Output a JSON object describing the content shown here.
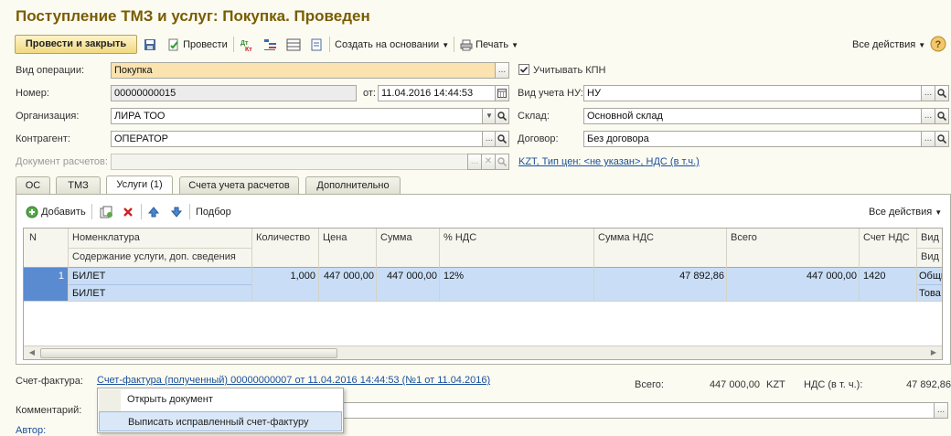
{
  "title": "Поступление ТМЗ и услуг: Покупка. Проведен",
  "toolbar": {
    "post_close": "Провести и закрыть",
    "post": "Провести",
    "create_based": "Создать на основании",
    "print": "Печать",
    "all_actions": "Все действия"
  },
  "form": {
    "operation_label": "Вид операции:",
    "operation_value": "Покупка",
    "kpn_label": "Учитывать КПН",
    "number_label": "Номер:",
    "number_value": "00000000015",
    "from_label": "от:",
    "date_value": "11.04.2016 14:44:53",
    "tax_account_label": "Вид учета НУ:",
    "tax_account_value": "НУ",
    "org_label": "Организация:",
    "org_value": "ЛИРА ТОО",
    "warehouse_label": "Склад:",
    "warehouse_value": "Основной склад",
    "contractor_label": "Контрагент:",
    "contractor_value": "ОПЕРАТОР",
    "contract_label": "Договор:",
    "contract_value": "Без договора",
    "settlement_doc_label": "Документ расчетов:",
    "price_link": "KZT, Тип цен: <не указан>, НДС (в т.ч.)"
  },
  "tabs": [
    "ОС",
    "ТМЗ",
    "Услуги (1)",
    "Счета учета расчетов",
    "Дополнительно"
  ],
  "table_toolbar": {
    "add": "Добавить",
    "selection": "Подбор",
    "all_actions": "Все действия"
  },
  "table": {
    "headers": {
      "n": "N",
      "nomenclature": "Номенклатура",
      "content": "Содержание услуги, доп. сведения",
      "qty": "Количество",
      "price": "Цена",
      "sum": "Сумма",
      "vat_pct": "% НДС",
      "vat_sum": "Сумма НДС",
      "total": "Всего",
      "vat_account": "Счет НДС",
      "type1": "Вид о",
      "type2": "Вид п"
    },
    "rows": [
      {
        "n": "1",
        "nomenclature": "БИЛЕТ",
        "content": "БИЛЕТ",
        "qty": "1,000",
        "price": "447 000,00",
        "sum": "447 000,00",
        "vat_pct": "12%",
        "vat_sum": "47 892,86",
        "total": "447 000,00",
        "vat_account": "1420",
        "type1": "Общи",
        "type2": "Това"
      }
    ]
  },
  "footer": {
    "invoice_label": "Счет-фактура:",
    "invoice_link": "Счет-фактура (полученный) 00000000007 от 11.04.2016 14:44:53 (№1 от 11.04.2016)",
    "total_label": "Всего:",
    "total_value": "447 000,00",
    "currency": "KZT",
    "vat_label": "НДС (в т. ч.):",
    "vat_value": "47 892,86",
    "comment_label": "Комментарий:",
    "author_label": "Автор:"
  },
  "popup_menu": {
    "items": [
      "Открыть документ",
      "Выписать исправленный счет-фактуру"
    ]
  },
  "colors": {
    "title": "#7a5c00",
    "primary_button": "#f1d980",
    "selected_row": "#c9def6",
    "link": "#1a4f9c"
  }
}
